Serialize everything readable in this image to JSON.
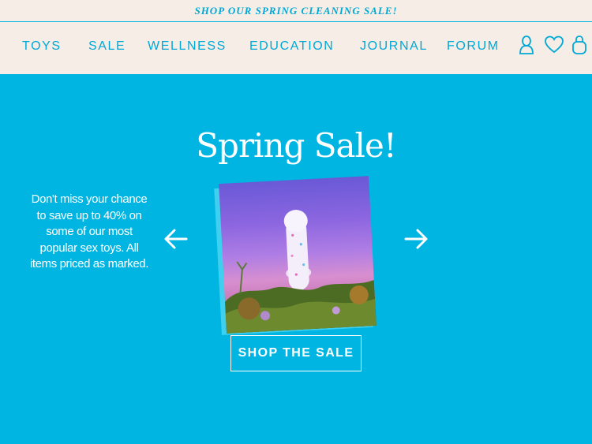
{
  "announcement": {
    "text": "SHOP OUR SPRING CLEANING SALE!"
  },
  "nav": {
    "items": [
      "TOYS",
      "SALE",
      "WELLNESS",
      "EDUCATION",
      "JOURNAL",
      "FORUM"
    ],
    "icons": [
      "account-icon",
      "heart-icon",
      "bag-icon"
    ]
  },
  "hero": {
    "title": "Spring Sale!",
    "description": "Don't miss your chance to save up to 40% on some of our most popular sex toys. All items priced as marked.",
    "cta_label": "SHOP THE SALE"
  },
  "colors": {
    "brand_blue": "#00b5e2",
    "nav_bg": "#f5ede6",
    "nav_text": "#00a9d6",
    "white": "#ffffff"
  }
}
